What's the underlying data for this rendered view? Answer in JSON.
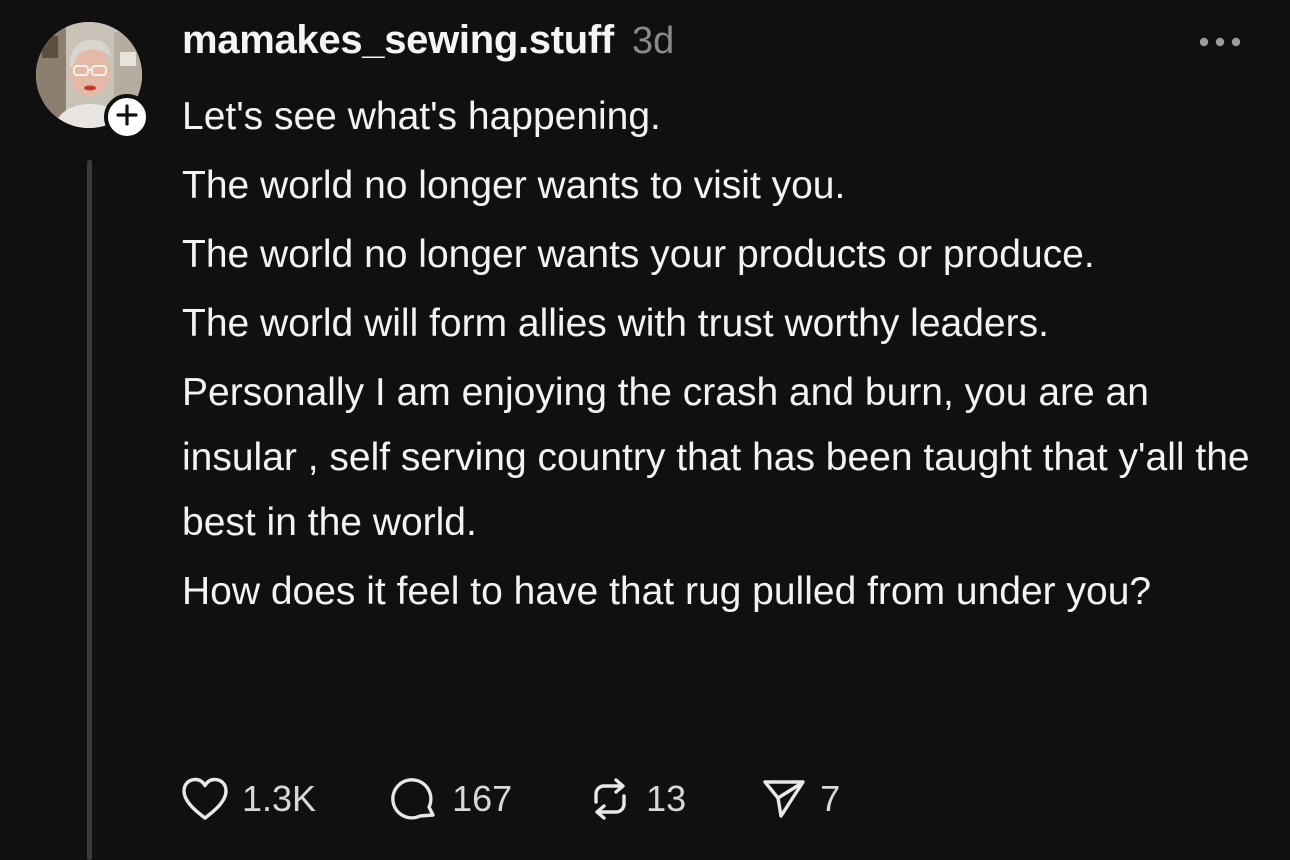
{
  "post": {
    "author": {
      "username": "mamakes_sewing.stuff",
      "timestamp": "3d",
      "avatar_icon": "profile-photo",
      "follow_icon": "plus-icon"
    },
    "more_icon": "more-horizontal-icon",
    "paragraphs": [
      "Let's see what's happening.",
      "The world no longer wants to visit you.",
      "The world no longer wants your products or produce.",
      "The world will form allies with trust worthy leaders.",
      "Personally I am enjoying the crash and burn, you are an insular , self serving country that has been taught that y'all the best in the world.",
      "How does it feel to have that rug pulled from under you?"
    ],
    "actions": {
      "like": {
        "icon": "heart-icon",
        "count": "1.3K"
      },
      "reply": {
        "icon": "comment-icon",
        "count": "167"
      },
      "repost": {
        "icon": "repost-icon",
        "count": "13"
      },
      "share": {
        "icon": "send-icon",
        "count": "7"
      }
    }
  },
  "colors": {
    "background": "#101010",
    "text": "#f3f3f3",
    "muted": "#8a8a8a",
    "thread_line": "#3a3a3a"
  }
}
